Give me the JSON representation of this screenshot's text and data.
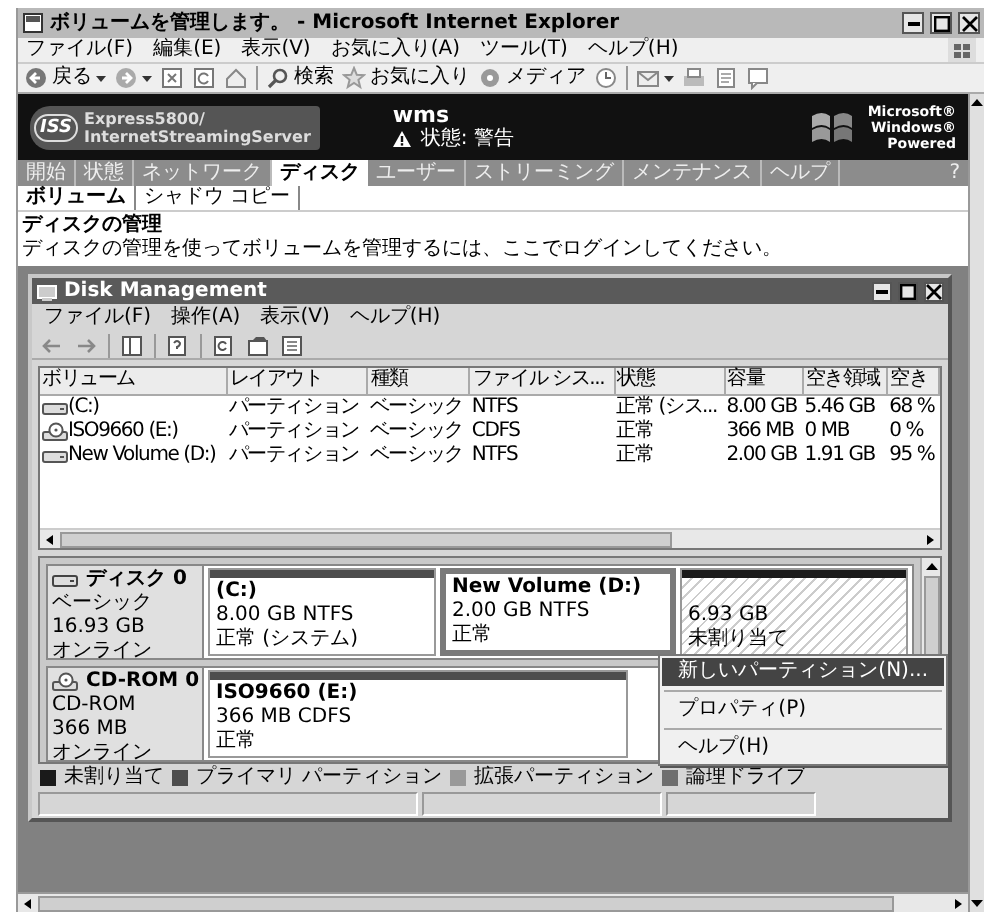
{
  "window": {
    "title": "ボリュームを管理します。 - Microsoft Internet Explorer"
  },
  "menu": [
    "ファイル(F)",
    "編集(E)",
    "表示(V)",
    "お気に入り(A)",
    "ツール(T)",
    "ヘルプ(H)"
  ],
  "toolbar": [
    {
      "kind": "back",
      "label": "戻る"
    },
    {
      "kind": "forward"
    },
    {
      "kind": "stop"
    },
    {
      "kind": "refresh"
    },
    {
      "kind": "home"
    },
    {
      "kind": "separator"
    },
    {
      "kind": "search",
      "label": "検索"
    },
    {
      "kind": "favorites",
      "label": "お気に入り"
    },
    {
      "kind": "media",
      "label": "メディア"
    },
    {
      "kind": "history"
    },
    {
      "kind": "separator"
    },
    {
      "kind": "mail"
    },
    {
      "kind": "print"
    },
    {
      "kind": "edit"
    },
    {
      "kind": "discuss"
    }
  ],
  "banner": {
    "logo_text": "ISS",
    "product": [
      "Express5800/",
      "InternetStreamingServer"
    ],
    "server": "wms",
    "status": "状態: 警告",
    "brand": [
      "Microsoft®",
      "Windows®",
      "Powered"
    ]
  },
  "nav_tabs": [
    {
      "label": "開始",
      "selected": false
    },
    {
      "label": "状態",
      "selected": false
    },
    {
      "label": "ネットワーク",
      "selected": false
    },
    {
      "label": "ディスク",
      "selected": true
    },
    {
      "label": "ユーザー",
      "selected": false
    },
    {
      "label": "ストリーミング",
      "selected": false
    },
    {
      "label": "メンテナンス",
      "selected": false
    },
    {
      "label": "ヘルプ",
      "selected": false
    }
  ],
  "help": "?",
  "sub_tabs": [
    {
      "label": "ボリューム",
      "selected": true
    },
    {
      "label": "シャドウ コピー",
      "selected": false
    }
  ],
  "heading": "ディスクの管理",
  "description": "ディスクの管理を使ってボリュームを管理するには、ここでログインしてください。",
  "disk_management": {
    "title": "Disk Management",
    "menu": [
      "ファイル(F)",
      "操作(A)",
      "表示(V)",
      "ヘルプ(H)"
    ],
    "columns": [
      "ボリューム",
      "レイアウト",
      "種類",
      "ファイル シス...",
      "状態",
      "容量",
      "空き領域",
      "空き"
    ],
    "rows": [
      {
        "kind": "disk",
        "cells": [
          "(C:)",
          "パーティション",
          "ベーシック",
          "NTFS",
          "正常 (シス...",
          "8.00 GB",
          "5.46 GB",
          "68 %"
        ]
      },
      {
        "kind": "cdrom",
        "cells": [
          "ISO9660 (E:)",
          "パーティション",
          "ベーシック",
          "CDFS",
          "正常",
          "366 MB",
          "0 MB",
          "0 %"
        ]
      },
      {
        "kind": "disk",
        "cells": [
          "New Volume (D:)",
          "パーティション",
          "ベーシック",
          "NTFS",
          "正常",
          "2.00 GB",
          "1.91 GB",
          "95 %"
        ]
      }
    ],
    "disks": [
      {
        "kind": "disk",
        "name": "ディスク 0",
        "info": [
          "ベーシック",
          "16.93 GB",
          "オンライン"
        ],
        "partitions": [
          {
            "kind": "primary",
            "name": "(C:)",
            "detail": "8.00 GB NTFS",
            "status": "正常 (システム)",
            "selected": false
          },
          {
            "kind": "primary",
            "name": "New Volume  (D:)",
            "detail": "2.00 GB NTFS",
            "status": "正常",
            "selected": true
          },
          {
            "kind": "unallocated",
            "detail": "6.93 GB",
            "status": "未割り当て",
            "selected": false
          }
        ]
      },
      {
        "kind": "cdrom",
        "name": "CD-ROM 0",
        "info": [
          "CD-ROM",
          "366 MB",
          "オンライン"
        ],
        "partitions": [
          {
            "kind": "primary",
            "name": "ISO9660  (E:)",
            "detail": "366 MB CDFS",
            "status": "正常",
            "selected": false
          }
        ]
      }
    ],
    "legend": [
      {
        "label": "未割り当て",
        "color": "#1a1a1a"
      },
      {
        "label": "プライマリ パーティション",
        "color": "#4d4d4d"
      },
      {
        "label": "拡張パーティション",
        "color": "#999999"
      },
      {
        "label": "論理ドライブ",
        "color": "#6e6e6e"
      }
    ],
    "context_menu": [
      {
        "label": "新しいパーティション(N)...",
        "selected": true
      },
      {
        "label": "プロパティ(P)",
        "selected": false
      },
      {
        "label": "ヘルプ(H)",
        "selected": false
      }
    ]
  }
}
